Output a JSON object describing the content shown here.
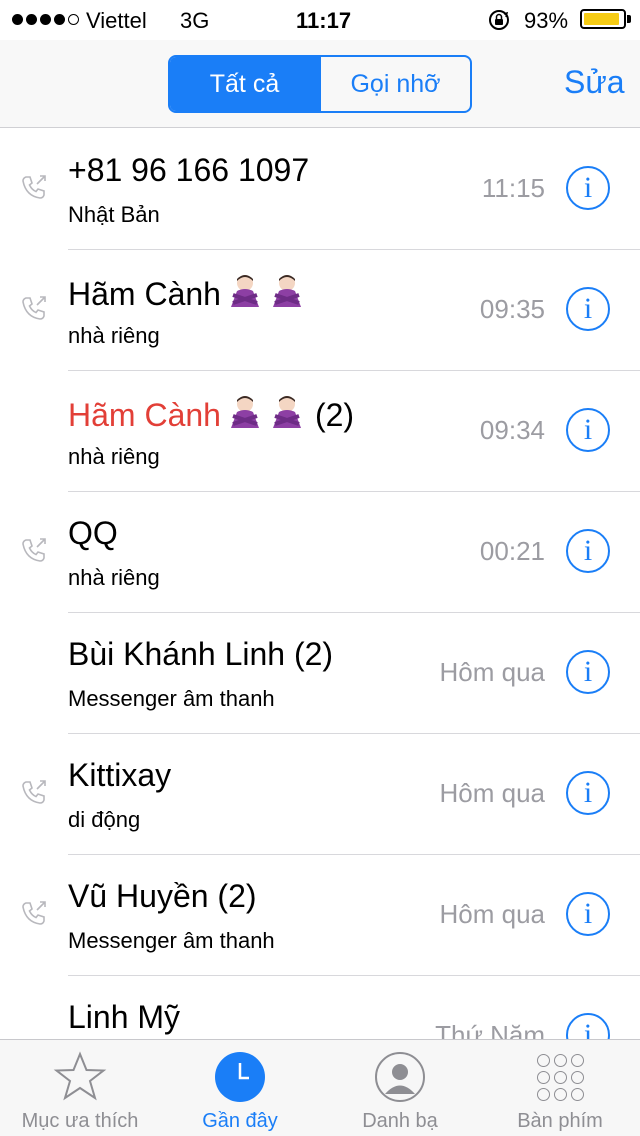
{
  "status_bar": {
    "carrier": "Viettel",
    "network": "3G",
    "time": "11:17",
    "battery_percent": "93%",
    "battery_level": 0.93,
    "signal_bars": 4
  },
  "navbar": {
    "segments": [
      "Tất cả",
      "Gọi nhỡ"
    ],
    "active_segment": 0,
    "edit_label": "Sửa"
  },
  "calls": [
    {
      "name": "+81 96 166 1097",
      "sub": "Nhật Bản",
      "time": "11:15",
      "outgoing": true,
      "missed": false,
      "emoji_count": 0
    },
    {
      "name": "Hãm Cành",
      "sub": "nhà riêng",
      "time": "09:35",
      "outgoing": true,
      "missed": false,
      "emoji_count": 2
    },
    {
      "name": "Hãm Cành",
      "count": "(2)",
      "sub": "nhà riêng",
      "time": "09:34",
      "outgoing": false,
      "missed": true,
      "emoji_count": 2
    },
    {
      "name": "QQ",
      "sub": "nhà riêng",
      "time": "00:21",
      "outgoing": true,
      "missed": false,
      "emoji_count": 0
    },
    {
      "name": "Bùi Khánh Linh (2)",
      "sub": "Messenger âm thanh",
      "time": "Hôm qua",
      "outgoing": false,
      "missed": false,
      "emoji_count": 0
    },
    {
      "name": "Kittixay",
      "sub": "di động",
      "time": "Hôm qua",
      "outgoing": true,
      "missed": false,
      "emoji_count": 0
    },
    {
      "name": "Vũ Huyền (2)",
      "sub": "Messenger âm thanh",
      "time": "Hôm qua",
      "outgoing": true,
      "missed": false,
      "emoji_count": 0
    },
    {
      "name": "Linh Mỹ",
      "sub": "",
      "time": "Thứ Năm",
      "outgoing": false,
      "missed": false,
      "emoji_count": 0
    }
  ],
  "info_glyph": "i",
  "tabs": [
    {
      "label": "Mục ưa thích",
      "icon": "star-icon"
    },
    {
      "label": "Gần đây",
      "icon": "clock-icon"
    },
    {
      "label": "Danh bạ",
      "icon": "contacts-icon"
    },
    {
      "label": "Bàn phím",
      "icon": "keypad-icon"
    }
  ],
  "active_tab": 1,
  "colors": {
    "accent": "#1a7ef7",
    "missed": "#e23f37",
    "battery": "#f6cc15"
  }
}
